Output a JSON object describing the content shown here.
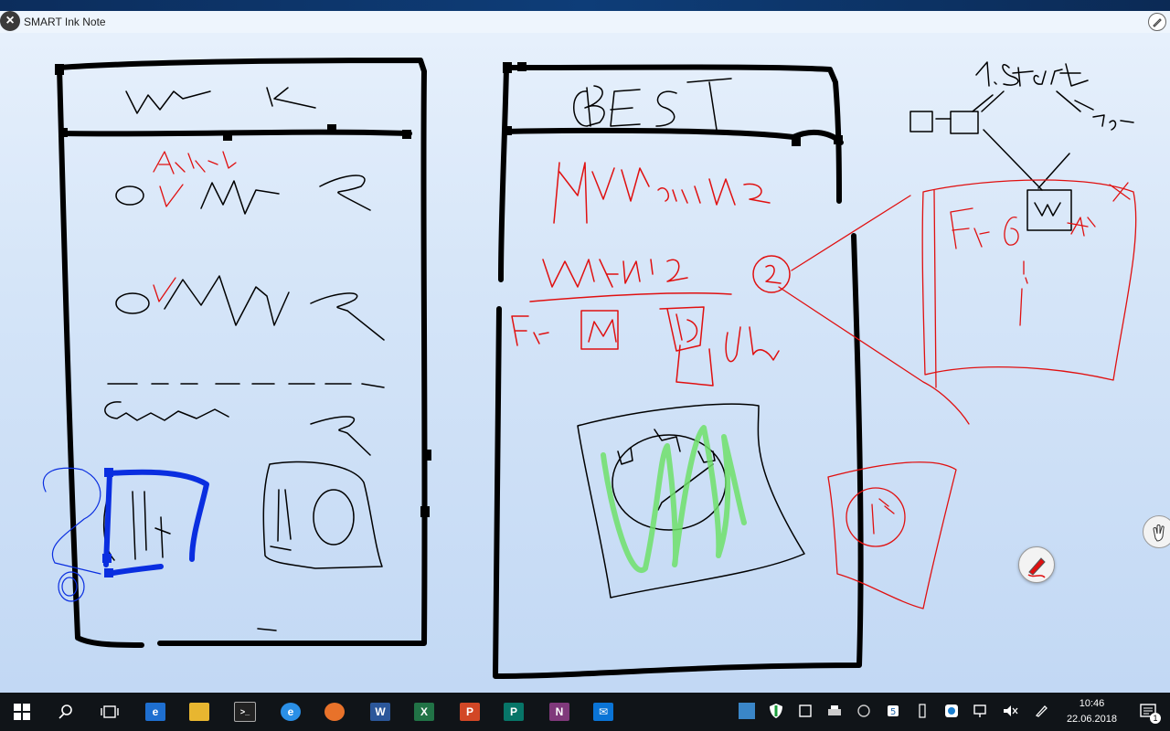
{
  "window": {
    "title": "SMART Ink Note"
  },
  "drawing": {
    "texts_black": [
      "W",
      "K",
      "BEST",
      "1. Start",
      "Frag",
      "Gesamt"
    ],
    "texts_red": [
      "Anzahl",
      "WANN und WO",
      "WANN?",
      "Fr",
      "Bis",
      "Uhr",
      "Fr",
      "X"
    ]
  },
  "taskbar": {
    "apps": [
      "start",
      "search",
      "task-view",
      "edge",
      "file-explorer",
      "command-prompt",
      "internet-explorer",
      "firefox",
      "word",
      "excel",
      "powerpoint",
      "publisher",
      "onenote",
      "mail"
    ],
    "clock_time": "10:46",
    "clock_date": "22.06.2018",
    "notification_count": "1"
  },
  "colors": {
    "ink_black": "#000000",
    "ink_red": "#e01010",
    "ink_blue": "#0a2ee0",
    "ink_green": "#6fe06a",
    "taskbar": "#101418"
  }
}
